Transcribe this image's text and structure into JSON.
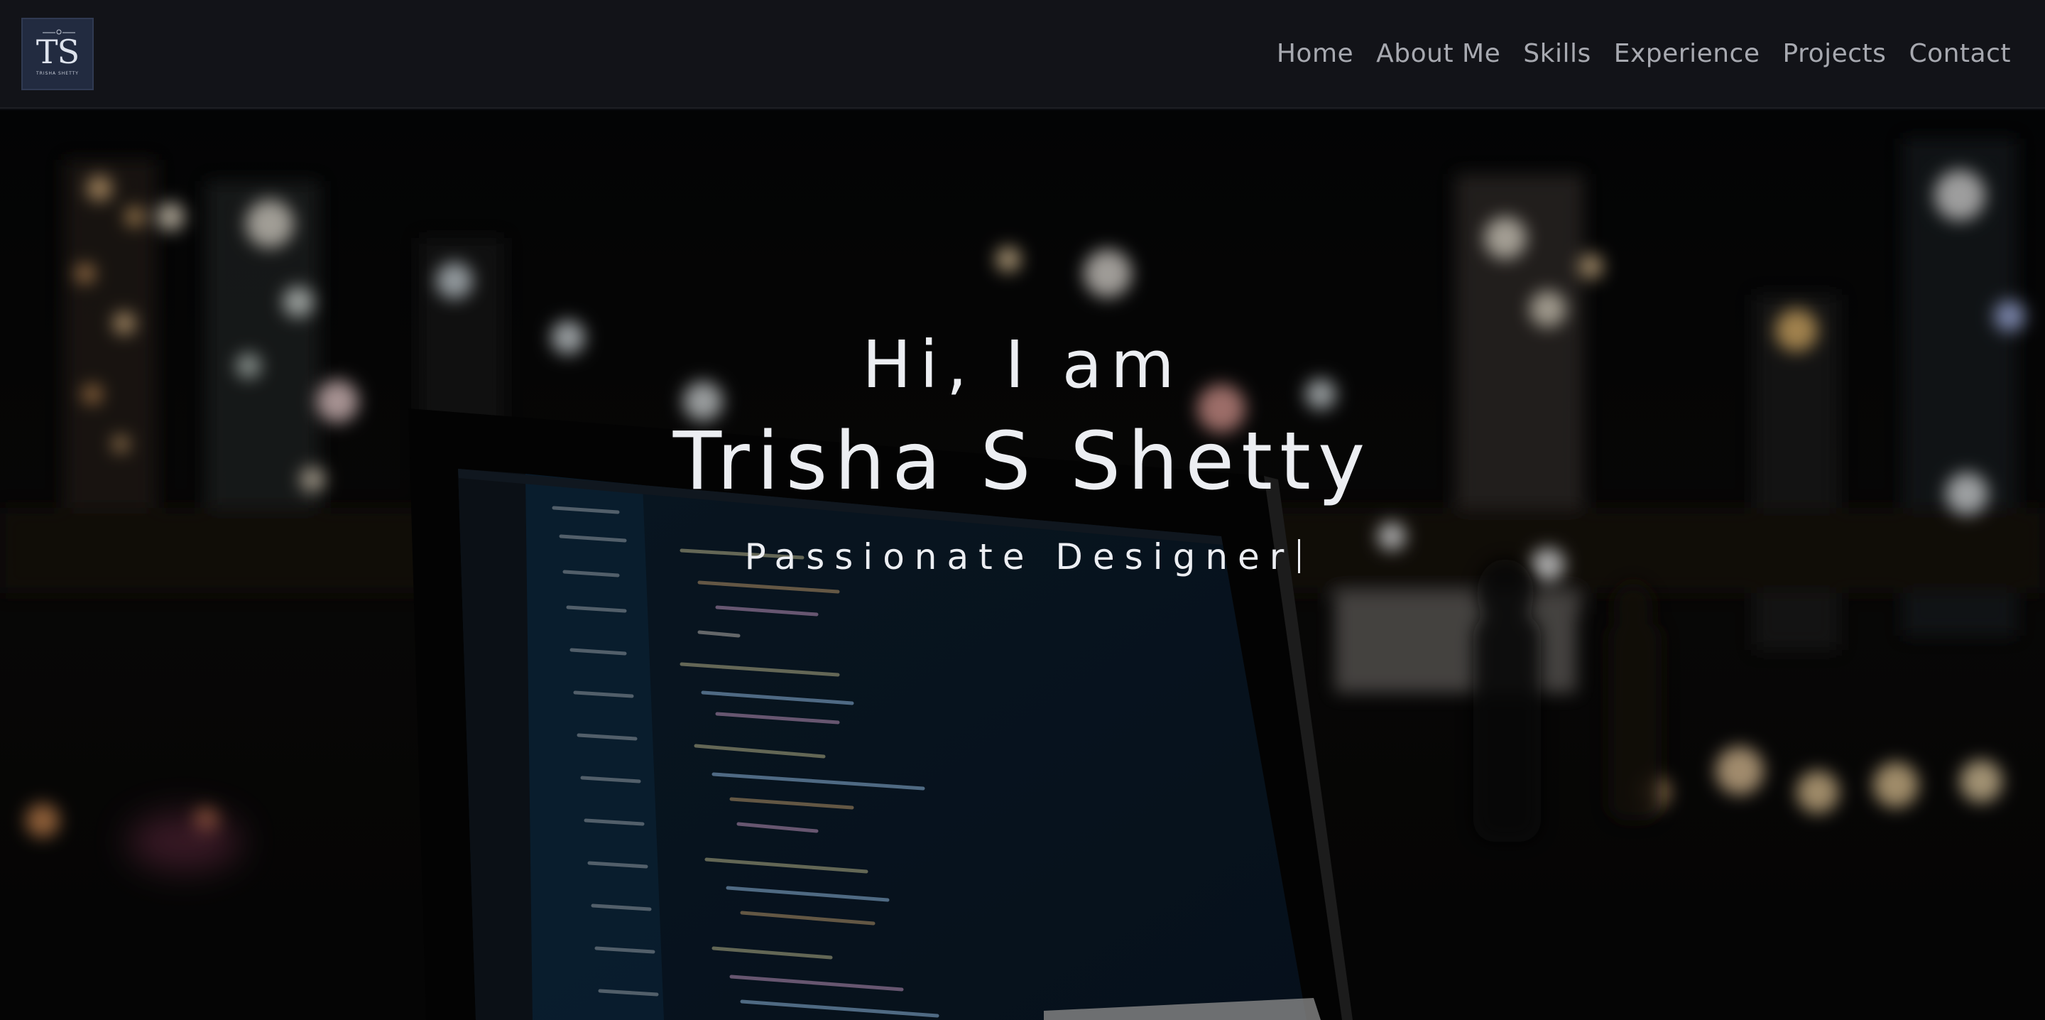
{
  "logo": {
    "monogram": "TS",
    "subtitle": "TRISHA SHETTY"
  },
  "nav": {
    "items": [
      {
        "label": "Home"
      },
      {
        "label": "About Me"
      },
      {
        "label": "Skills"
      },
      {
        "label": "Experience"
      },
      {
        "label": "Projects"
      },
      {
        "label": "Contact"
      }
    ]
  },
  "hero": {
    "greeting": "Hi, I am",
    "name": "Trisha S Shetty",
    "tagline": "Passionate Designer"
  },
  "colors": {
    "navbar_bg": "#121318",
    "nav_text": "#a7a9b0",
    "logo_bg": "#222b40",
    "hero_text": "#eceef2"
  }
}
